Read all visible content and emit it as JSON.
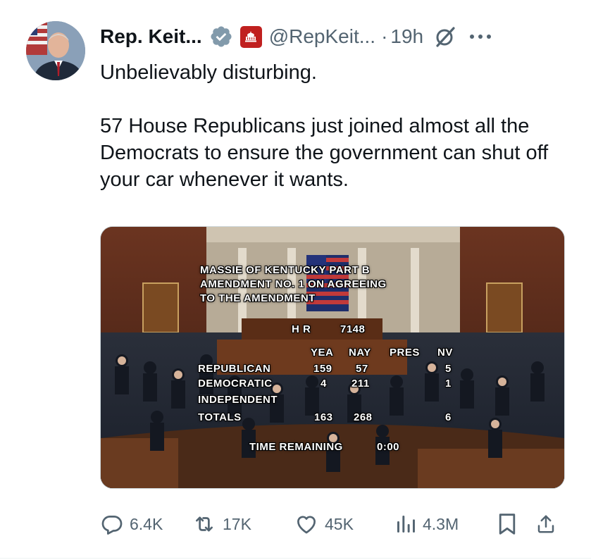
{
  "post": {
    "display_name": "Rep. Keit...",
    "handle": "@RepKeit...",
    "separator": "·",
    "time": "19h",
    "text_line1": "Unbelievably disturbing.",
    "text_line2": "57 House Republicans just joined almost all the Democrats to ensure the government can shut off your car whenever it wants."
  },
  "media": {
    "title_lines": [
      "MASSIE OF KENTUCKY PART B",
      "AMENDMENT NO. 1 ON AGREEING",
      "TO THE AMENDMENT"
    ],
    "bill": "H R",
    "bill_number": "7148",
    "columns": [
      "YEA",
      "NAY",
      "PRES",
      "NV"
    ],
    "rows": [
      {
        "party": "REPUBLICAN",
        "yea": "159",
        "nay": "57",
        "pres": "",
        "nv": "5"
      },
      {
        "party": "DEMOCRATIC",
        "yea": "4",
        "nay": "211",
        "pres": "",
        "nv": "1"
      },
      {
        "party": "INDEPENDENT",
        "yea": "",
        "nay": "",
        "pres": "",
        "nv": ""
      },
      {
        "party": "TOTALS",
        "yea": "163",
        "nay": "268",
        "pres": "",
        "nv": "6"
      }
    ],
    "time_remaining_label": "TIME REMAINING",
    "time_remaining_value": "0:00"
  },
  "actions": {
    "replies": "6.4K",
    "reposts": "17K",
    "likes": "45K",
    "views": "4.3M"
  },
  "icons": {
    "reply": "reply-icon",
    "repost": "repost-icon",
    "like": "like-icon",
    "views": "views-icon",
    "bookmark": "bookmark-icon",
    "share": "share-icon",
    "verified": "verified-badge-icon",
    "affiliation": "capitol-icon",
    "grok": "grok-icon",
    "more": "more-icon"
  },
  "colors": {
    "text": "#0f1419",
    "secondary": "#536471",
    "verified_badge": "#829aab",
    "affiliation_badge": "#c0201f"
  }
}
